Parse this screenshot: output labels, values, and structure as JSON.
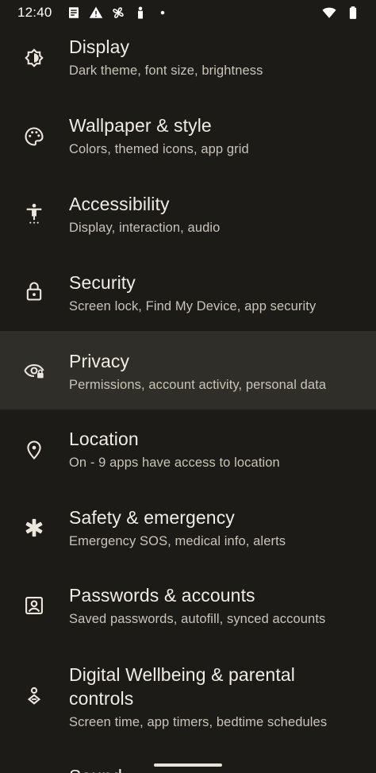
{
  "status_bar": {
    "time": "12:40",
    "left_icons": [
      "news-icon",
      "alert-icon",
      "fan-icon",
      "accessibility-person-icon",
      "dot-icon"
    ],
    "right_icons": [
      "wifi-icon",
      "battery-icon"
    ]
  },
  "settings": {
    "items": [
      {
        "title": "Display",
        "subtitle": "Dark theme, font size, brightness",
        "icon": "brightness-icon"
      },
      {
        "title": "Wallpaper & style",
        "subtitle": "Colors, themed icons, app grid",
        "icon": "palette-icon"
      },
      {
        "title": "Accessibility",
        "subtitle": "Display, interaction, audio",
        "icon": "accessibility-icon"
      },
      {
        "title": "Security",
        "subtitle": "Screen lock, Find My Device, app security",
        "icon": "lock-icon"
      },
      {
        "title": "Privacy",
        "subtitle": "Permissions, account activity, personal data",
        "icon": "eye-lock-icon"
      },
      {
        "title": "Location",
        "subtitle": "On - 9 apps have access to location",
        "icon": "location-pin-icon"
      },
      {
        "title": "Safety & emergency",
        "subtitle": "Emergency SOS, medical info, alerts",
        "icon": "asterisk-icon"
      },
      {
        "title": "Passwords & accounts",
        "subtitle": "Saved passwords, autofill, synced accounts",
        "icon": "account-box-icon"
      },
      {
        "title": "Digital Wellbeing & parental controls",
        "subtitle": "Screen time, app timers, bedtime schedules",
        "icon": "wellbeing-icon"
      },
      {
        "title": "Sound",
        "subtitle": "",
        "icon": ""
      }
    ]
  },
  "colors": {
    "background": "#1c1b17",
    "highlight_row": "#302e29",
    "title_text": "#f1ece3",
    "subtitle_text": "#c9c3b8"
  }
}
